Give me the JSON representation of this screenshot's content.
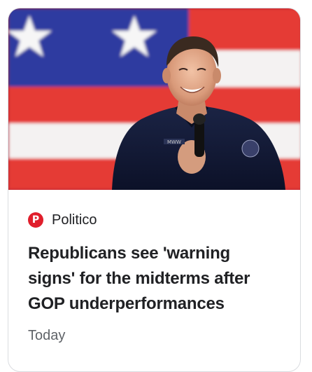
{
  "article": {
    "source": {
      "name": "Politico",
      "logo_letter": "P",
      "logo_color": "#e01e2b"
    },
    "headline": "Republicans see 'warning signs' for the midterms after GOP underperformances",
    "timestamp": "Today",
    "image": {
      "jacket_patch_text": "MWW"
    }
  },
  "colors": {
    "flag_red": "#e53b34",
    "flag_white": "#f4f2f2",
    "flag_blue": "#2d3aa0",
    "text_primary": "#202124",
    "text_secondary": "#5f6368",
    "card_border": "#dadce0"
  }
}
